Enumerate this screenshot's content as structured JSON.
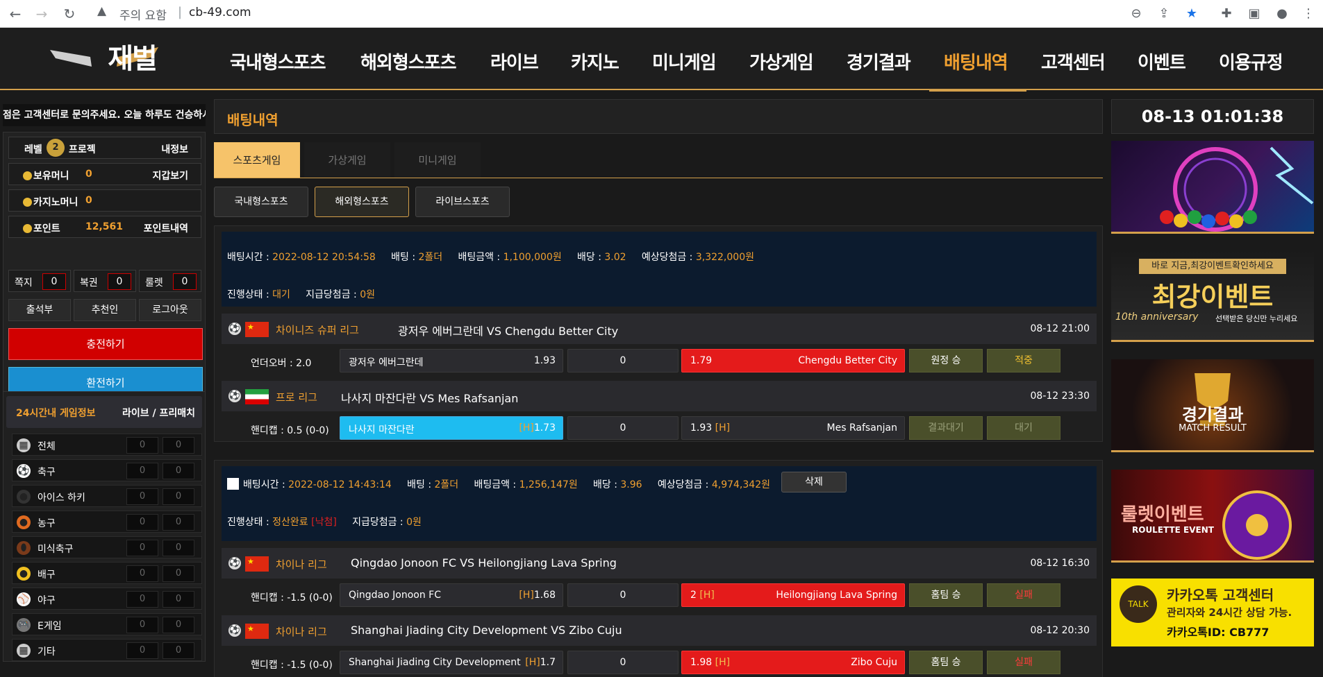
{
  "browser": {
    "warning_text": "주의 요함",
    "url": "cb-49.com"
  },
  "site": {
    "logo_text": "재벌",
    "menu": [
      "국내형스포츠",
      "해외형스포츠",
      "라이브",
      "카지노",
      "미니게임",
      "가상게임",
      "경기결과",
      "배팅내역",
      "고객센터",
      "이벤트",
      "이용규정"
    ],
    "active_menu": "배팅내역"
  },
  "sidebar": {
    "ticker": "점은 고객센터로 문의주세요. 오늘 하루도 건승하시",
    "level_label": "레벨",
    "level_value": "2",
    "level_name": "프로젝",
    "my_info": "내정보",
    "money_label": "보유머니",
    "money_value": "0",
    "wallet_link": "지갑보기",
    "casino_label": "카지노머니",
    "casino_value": "0",
    "point_label": "포인트",
    "point_value": "12,561",
    "point_link": "포인트내역",
    "note_label": "쪽지",
    "note_count": "0",
    "lottery_label": "복권",
    "lottery_count": "0",
    "roulette_label": "룰렛",
    "roulette_count": "0",
    "attendance": "출석부",
    "referral": "추천인",
    "logout": "로그아웃",
    "charge": "충전하기",
    "exchange": "환전하기",
    "game_info_title": "24시간내 게임정보",
    "game_info_mode": "라이브 / 프리매치",
    "games": [
      {
        "label": "전체",
        "a": "0",
        "b": "0",
        "icon": "all-icon"
      },
      {
        "label": "축구",
        "a": "0",
        "b": "0",
        "icon": "soccer-icon"
      },
      {
        "label": "아이스 하키",
        "a": "0",
        "b": "0",
        "icon": "hockey-icon"
      },
      {
        "label": "농구",
        "a": "0",
        "b": "0",
        "icon": "basketball-icon"
      },
      {
        "label": "미식축구",
        "a": "0",
        "b": "0",
        "icon": "football-icon"
      },
      {
        "label": "배구",
        "a": "0",
        "b": "0",
        "icon": "volleyball-icon"
      },
      {
        "label": "야구",
        "a": "0",
        "b": "0",
        "icon": "baseball-icon"
      },
      {
        "label": "E게임",
        "a": "0",
        "b": "0",
        "icon": "gamepad-icon"
      },
      {
        "label": "기타",
        "a": "0",
        "b": "0",
        "icon": "etc-icon"
      }
    ]
  },
  "main": {
    "title": "배팅내역",
    "tabs": [
      "스포츠게임",
      "가상게임",
      "미니게임"
    ],
    "sub_tabs": [
      "국내형스포츠",
      "해외형스포츠",
      "라이브스포츠"
    ],
    "bets": [
      {
        "time_label": "배팅시간 : ",
        "time": "2022-08-12 20:54:58",
        "fold_label": "배팅 : ",
        "fold": "2폴더",
        "amount_label": "배팅금액 : ",
        "amount": "1,100,000원",
        "odds_label": "배당 : ",
        "odds": "3.02",
        "expected_label": "예상당첨금 : ",
        "expected": "3,322,000원",
        "status_label": "진행상태 : ",
        "status": "대기",
        "paid_label": "지급당첨금 : ",
        "paid": "0원",
        "matches": [
          {
            "league": "차이니즈 슈퍼 리그",
            "teams": "광저우 에버그란데 VS Chengdu Better City",
            "time": "08-12 21:00",
            "type": "언더오버 : 2.0",
            "home": "광저우 에버그란데",
            "home_odds": "1.93",
            "home_mark": "",
            "mid": "0",
            "away": "Chengdu Better City",
            "away_odds": "1.79",
            "away_mark": "",
            "pick": "원정 승",
            "result": "적중"
          },
          {
            "league": "프로 리그",
            "teams": "나사지 마잔다란 VS Mes Rafsanjan",
            "time": "08-12 23:30",
            "type": "핸디캡 : 0.5 (0-0)",
            "home": "나사지 마잔다란",
            "home_odds": "1.73",
            "home_mark": "[H]",
            "mid": "0",
            "away": "Mes Rafsanjan",
            "away_odds": "1.93",
            "away_mark": "[H]",
            "pick": "결과대기",
            "result": "대기"
          }
        ]
      },
      {
        "time_label": "배팅시간 : ",
        "time": "2022-08-12 14:43:14",
        "fold_label": "배팅 : ",
        "fold": "2폴더",
        "amount_label": "배팅금액 : ",
        "amount": "1,256,147원",
        "odds_label": "배당 : ",
        "odds": "3.96",
        "expected_label": "예상당첨금 : ",
        "expected": "4,974,342원",
        "delete": "삭제",
        "status_label": "진행상태 : ",
        "status": "정산완료",
        "status_result": "[낙첨]",
        "paid_label": "지급당첨금 : ",
        "paid": "0원",
        "matches": [
          {
            "league": "차이나 리그",
            "teams": "Qingdao Jonoon FC VS Heilongjiang Lava Spring",
            "time": "08-12 16:30",
            "type": "핸디캡 : -1.5 (0-0)",
            "home": "Qingdao Jonoon FC",
            "home_odds": "1.68",
            "home_mark": "[H]",
            "mid": "0",
            "away": "Heilongjiang Lava Spring",
            "away_odds": "2",
            "away_mark": "[H]",
            "pick": "홈팀 승",
            "result": "실패"
          },
          {
            "league": "차이나 리그",
            "teams": "Shanghai Jiading City Development VS Zibo Cuju",
            "time": "08-12 20:30",
            "type": "핸디캡 : -1.5 (0-0)",
            "home": "Shanghai Jiading City Development",
            "home_odds": "1.7",
            "home_mark": "[H]",
            "mid": "0",
            "away": "Zibo Cuju",
            "away_odds": "1.98",
            "away_mark": "[H]",
            "pick": "홈팀 승",
            "result": "실패"
          }
        ]
      }
    ]
  },
  "right": {
    "clock": "08-13 01:01:38",
    "banner2_top": "바로 지금,최강이벤트확인하세요",
    "banner2_main": "최강이벤트",
    "banner2_sub_a": "10th anniversary",
    "banner2_sub_b": "선택받은 당신만 누리세요",
    "banner3_main": "경기결과",
    "banner3_sub": "MATCH RESULT",
    "banner4_main": "룰렛이벤트",
    "banner4_sub": "ROULETTE EVENT",
    "banner5_title": "카카오톡 고객센터",
    "banner5_sub": "관리자와 24시간 상담 가능.",
    "banner5_id": "카카오톡ID: CB777"
  },
  "colors": {
    "accent": "#f0a030",
    "gold_line": "#d4a04b",
    "red": "#e41b1b",
    "blue": "#1ebcf0"
  }
}
